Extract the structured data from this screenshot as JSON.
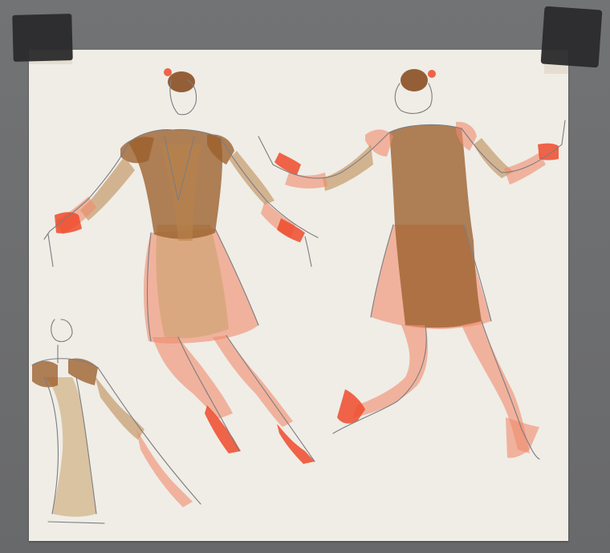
{
  "image": {
    "subject": "costume-sketch",
    "palette": {
      "background": "#6b6c6e",
      "paper": "#efede6",
      "tape": "#2a2a2c",
      "brown": "#9b5f2c",
      "salmon": "#f08a6d",
      "red": "#ee4a2c"
    },
    "figures": [
      "dancer-front",
      "dancer-back",
      "figure-study-small"
    ]
  }
}
